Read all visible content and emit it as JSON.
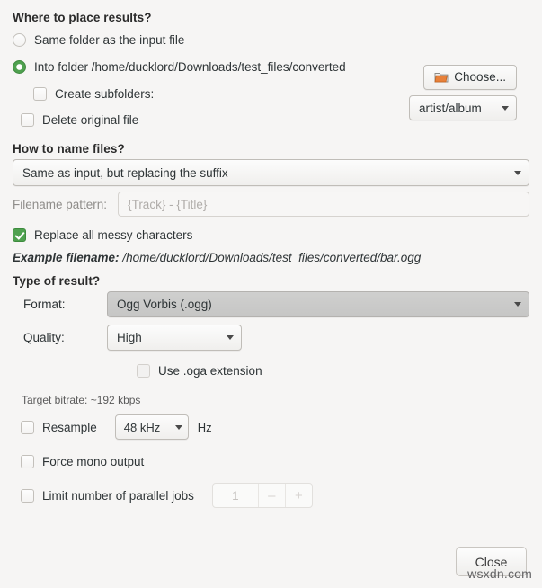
{
  "sections": {
    "placement": {
      "title": "Where to place results?",
      "option_same_folder": "Same folder as the input file",
      "option_into_folder": "Into folder /home/ducklord/Downloads/test_files/converted",
      "choose_button": "Choose...",
      "create_subfolders": "Create subfolders:",
      "subfolders_value": "artist/album",
      "delete_original": "Delete original file"
    },
    "naming": {
      "title": "How to name files?",
      "scheme_value": "Same as input, but replacing the suffix",
      "pattern_label": "Filename pattern:",
      "pattern_placeholder": "{Track} - {Title}",
      "replace_messy": "Replace all messy characters",
      "example_label": "Example filename:",
      "example_value": "/home/ducklord/Downloads/test_files/converted/bar.ogg"
    },
    "result": {
      "title": "Type of result?",
      "format_label": "Format:",
      "format_value": "Ogg Vorbis (.ogg)",
      "quality_label": "Quality:",
      "quality_value": "High",
      "use_oga": "Use .oga extension",
      "bitrate": "Target bitrate: ~192 kbps",
      "resample": "Resample",
      "resample_value": "48 kHz",
      "resample_unit": "Hz",
      "force_mono": "Force mono output",
      "limit_jobs": "Limit number of parallel jobs",
      "jobs_value": "1",
      "jobs_minus": "–",
      "jobs_plus": "+"
    }
  },
  "footer": {
    "close_label": "Close"
  },
  "watermark": {
    "text": "wsxdn.com"
  },
  "colors": {
    "accent_green": "#4fa14f",
    "background": "#f6f5f4",
    "folder_orange": "#e8813a"
  }
}
